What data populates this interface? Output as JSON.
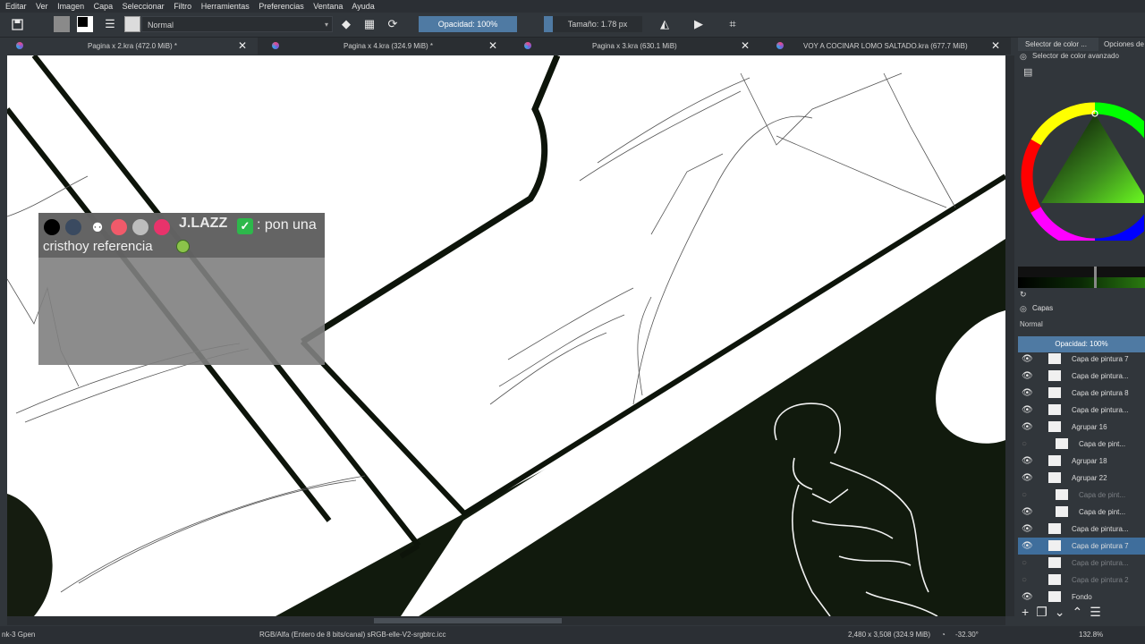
{
  "menubar": {
    "items": [
      "Editar",
      "Ver",
      "Imagen",
      "Capa",
      "Seleccionar",
      "Filtro",
      "Herramientas",
      "Preferencias",
      "Ventana",
      "Ayuda"
    ]
  },
  "toolbar": {
    "blend_mode": "Normal",
    "opacity_label": "Opacidad: 100%",
    "size_label": "Tamaño: 1.78 px"
  },
  "tabs": [
    {
      "label": "Pagina x 2.kra (472.0 MiB) *"
    },
    {
      "label": "Pagina x 4.kra (324.9 MiB) *"
    },
    {
      "label": "Pagina x 3.kra (630.1 MiB)"
    },
    {
      "label": "VOY A COCINAR LOMO SALTADO.kra (677.7 MiB)"
    }
  ],
  "chat": {
    "user": "J.LAZZ",
    "message_line1": ": pon una",
    "message_line2": "cristhoy referencia"
  },
  "right_panel": {
    "tab1": "Selector de color ...",
    "tab2": "Opciones de",
    "color_title": "Selector de color avanzado",
    "layers_title": "Capas",
    "blend_mode": "Normal",
    "opacity": "Opacidad:  100%",
    "layers": [
      {
        "name": "Capa de pintura 7",
        "visible": true,
        "dim": false
      },
      {
        "name": "Capa de pintura...",
        "visible": true,
        "dim": false
      },
      {
        "name": "Capa de pintura 8",
        "visible": true,
        "dim": false
      },
      {
        "name": "Capa de pintura...",
        "visible": true,
        "dim": false
      },
      {
        "name": "Agrupar 16",
        "visible": true,
        "dim": false
      },
      {
        "name": "Capa de pint...",
        "visible": false,
        "dim": false
      },
      {
        "name": "Agrupar 18",
        "visible": true,
        "dim": false
      },
      {
        "name": "Agrupar 22",
        "visible": true,
        "dim": false
      },
      {
        "name": "Capa de pint...",
        "visible": false,
        "dim": true
      },
      {
        "name": "Capa de pint...",
        "visible": true,
        "dim": false
      },
      {
        "name": "Capa de pintura...",
        "visible": true,
        "dim": false
      },
      {
        "name": "Capa de pintura 7",
        "visible": true,
        "dim": false,
        "selected": true
      },
      {
        "name": "Capa de pintura...",
        "visible": false,
        "dim": true
      },
      {
        "name": "Capa de pintura 2",
        "visible": false,
        "dim": true
      },
      {
        "name": "Fondo",
        "visible": true,
        "dim": false
      }
    ]
  },
  "status": {
    "brush": "nk-3 Gpen",
    "colorspace": "RGB/Alfa (Entero de 8 bits/canal)  sRGB-elle-V2-srgbtrc.icc",
    "dimensions": "2,480 x 3,508 (324.9 MiB)",
    "rotation": "-32.30°",
    "zoom": "132.8%"
  }
}
